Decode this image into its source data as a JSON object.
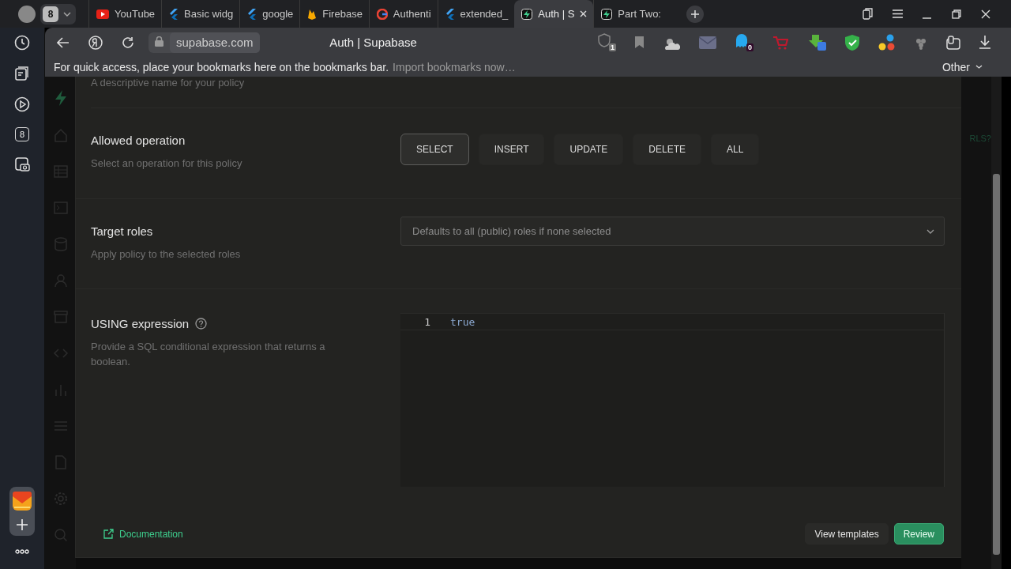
{
  "browser": {
    "tab_count": "8",
    "tabs": [
      {
        "title": "YouTube",
        "kind": "youtube",
        "selected": false
      },
      {
        "title": "Basic widg",
        "kind": "flutter",
        "selected": false
      },
      {
        "title": "google",
        "kind": "flutter",
        "selected": false
      },
      {
        "title": "Firebase",
        "kind": "firebase",
        "selected": false
      },
      {
        "title": "Authenti",
        "kind": "google",
        "selected": false
      },
      {
        "title": "extended_",
        "kind": "flutter",
        "selected": false
      },
      {
        "title": "Auth | S",
        "kind": "supabase",
        "selected": true
      },
      {
        "title": "Part Two: ",
        "kind": "supabase",
        "selected": false
      }
    ],
    "address": "supabase.com",
    "page_title": "Auth | Supabase",
    "extension_badges": [
      "1",
      "0"
    ],
    "bookmarks_hint": "For quick access, place your bookmarks here on the bookmarks bar.",
    "bookmarks_link": "Import bookmarks now…",
    "other_bookmarks": "Other"
  },
  "side_panel": {
    "counter": "8"
  },
  "backdrop": {
    "fragment": "RLS?"
  },
  "policy_form": {
    "name_hint": "A descriptive name for your policy",
    "sections": [
      {
        "kind": "operations",
        "title": "Allowed operation",
        "description": "Select an operation for this policy",
        "operations": [
          {
            "label": "SELECT",
            "selected": true
          },
          {
            "label": "INSERT",
            "selected": false
          },
          {
            "label": "UPDATE",
            "selected": false
          },
          {
            "label": "DELETE",
            "selected": false
          },
          {
            "label": "ALL",
            "selected": false
          }
        ]
      },
      {
        "kind": "roles",
        "title": "Target roles",
        "description": "Apply policy to the selected roles",
        "placeholder": "Defaults to all (public) roles if none selected"
      },
      {
        "kind": "expression",
        "title": "USING expression",
        "description": "Provide a SQL conditional expression that returns a boolean.",
        "lines": [
          {
            "number": "1",
            "code": "true"
          }
        ]
      }
    ],
    "documentation_link": "Documentation",
    "buttons": [
      {
        "label": "View templates",
        "kind": "secondary"
      },
      {
        "label": "Review",
        "kind": "primary"
      }
    ]
  }
}
